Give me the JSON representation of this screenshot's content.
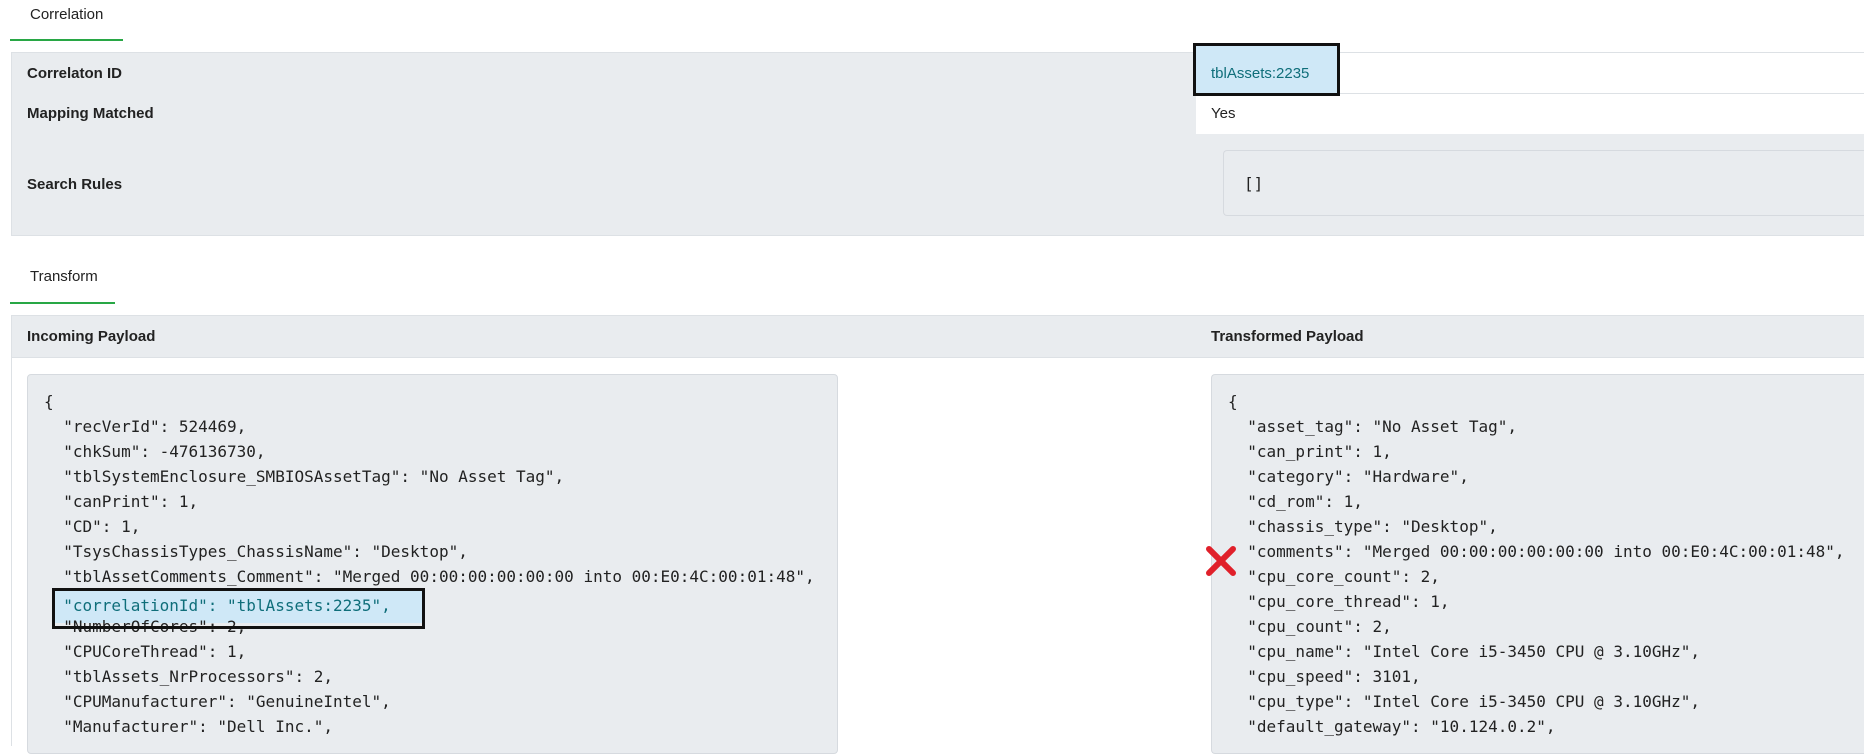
{
  "tabs": {
    "correlation": "Correlation",
    "transform": "Transform"
  },
  "correlation_table": {
    "rows": [
      {
        "label": "Correlaton ID",
        "value": "tblAssets:2235"
      },
      {
        "label": "Mapping Matched",
        "value": "Yes"
      },
      {
        "label": "Search Rules",
        "value": "[]"
      }
    ]
  },
  "transform_table": {
    "incoming_header": "Incoming Payload",
    "transformed_header": "Transformed Payload",
    "incoming_lines": [
      "{",
      "  \"recVerId\": 524469,",
      "  \"chkSum\": -476136730,",
      "  \"tblSystemEnclosure_SMBIOSAssetTag\": \"No Asset Tag\",",
      "  \"canPrint\": 1,",
      "  \"CD\": 1,",
      "  \"TsysChassisTypes_ChassisName\": \"Desktop\",",
      "  \"tblAssetComments_Comment\": \"Merged 00:00:00:00:00:00 into 00:E0:4C:00:01:48\",",
      "  \"correlationId\": \"tblAssets:2235\",",
      "  \"NumberOfCores\": 2,",
      "  \"CPUCoreThread\": 1,",
      "  \"tblAssets_NrProcessors\": 2,",
      "  \"CPUManufacturer\": \"GenuineIntel\",",
      "  \"Manufacturer\": \"Dell Inc.\","
    ],
    "transformed_lines": [
      "{",
      "  \"asset_tag\": \"No Asset Tag\",",
      "  \"can_print\": 1,",
      "  \"category\": \"Hardware\",",
      "  \"cd_rom\": 1,",
      "  \"chassis_type\": \"Desktop\",",
      "  \"comments\": \"Merged 00:00:00:00:00:00 into 00:E0:4C:00:01:48\",",
      "  \"cpu_core_count\": 2,",
      "  \"cpu_core_thread\": 1,",
      "  \"cpu_count\": 2,",
      "  \"cpu_name\": \"Intel Core i5-3450 CPU @ 3.10GHz\",",
      "  \"cpu_speed\": 3101,",
      "  \"cpu_type\": \"Intel Core i5-3450 CPU @ 3.10GHz\",",
      "  \"default_gateway\": \"10.124.0.2\","
    ]
  },
  "colors": {
    "accent_green": "#28a745",
    "highlight_blue": "#cfe8f7",
    "error_red": "#e0202a",
    "link_teal": "#0f6e7a"
  },
  "icons": {
    "error_marker": "x-mark-icon"
  }
}
